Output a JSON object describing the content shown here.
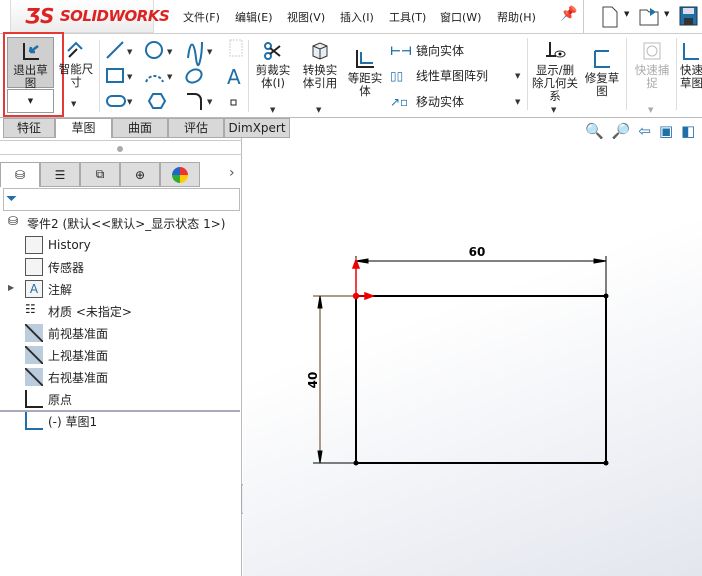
{
  "app": {
    "logo_text": "SOLIDWORKS"
  },
  "menu": [
    "文件(F)",
    "编辑(E)",
    "视图(V)",
    "插入(I)",
    "工具(T)",
    "窗口(W)",
    "帮助(H)"
  ],
  "ribbon": {
    "exit_sketch": "退出草图",
    "smart_dimension": "智能尺寸",
    "trim": "剪裁实体(I)",
    "convert": "转换实体引用",
    "offset": "等距实体",
    "mirror": "镜向实体",
    "linear_pattern": "线性草图阵列",
    "move": "移动实体",
    "display_delete": "显示/删除几何关系",
    "repair": "修复草图",
    "quick_snap": "快速捕捉",
    "quick_view": "快速草图"
  },
  "tabs": [
    "特征",
    "草图",
    "曲面",
    "评估",
    "DimXpert"
  ],
  "active_tab": "草图",
  "tree": {
    "root": "零件2  (默认<<默认>_显示状态 1>)",
    "items": [
      "History",
      "传感器",
      "注解",
      "材质 <未指定>",
      "前视基准面",
      "上视基准面",
      "右视基准面",
      "原点"
    ],
    "sketch": "(-) 草图1"
  },
  "drawing": {
    "width_dim": "60",
    "height_dim": "40"
  },
  "colors": {
    "accent": "#1f6fa8",
    "highlight": "#e53935",
    "brand": "#d22222"
  }
}
